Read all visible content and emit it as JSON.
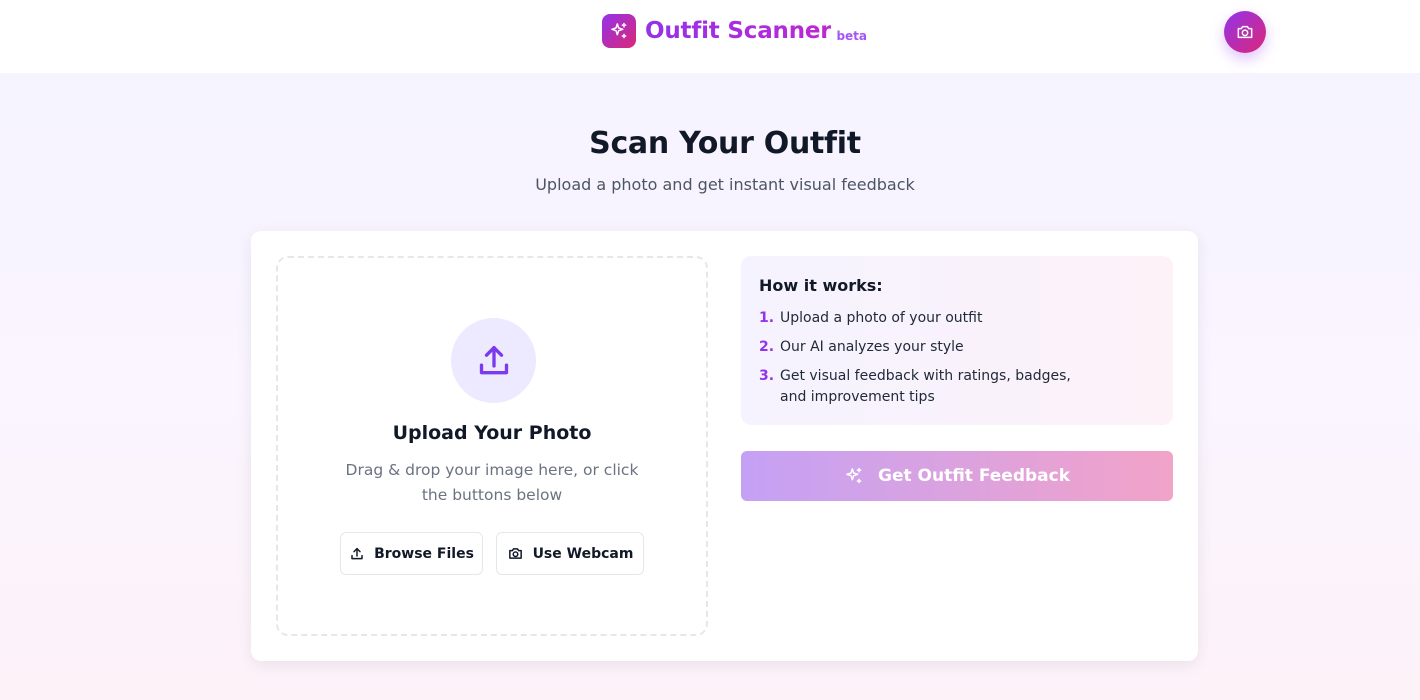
{
  "header": {
    "app_name": "Outfit Scanner",
    "badge": "beta",
    "logo_icon": "sparkles-icon",
    "camera_icon": "camera-icon"
  },
  "hero": {
    "title": "Scan Your Outfit",
    "subtitle": "Upload a photo and get instant visual feedback"
  },
  "upload": {
    "icon": "upload-icon",
    "title": "Upload Your Photo",
    "description": "Drag & drop your image here, or click the buttons below",
    "browse_label": "Browse Files",
    "webcam_label": "Use Webcam"
  },
  "how_it_works": {
    "title": "How it works:",
    "steps": [
      {
        "num": "1.",
        "text": "Upload a photo of your outfit"
      },
      {
        "num": "2.",
        "text": "Our AI analyzes your style"
      },
      {
        "num": "3.",
        "text": "Get visual feedback with ratings, badges, and improvement tips"
      }
    ]
  },
  "actions": {
    "feedback_label": "Get Outfit Feedback",
    "feedback_icon": "sparkles-icon"
  },
  "colors": {
    "accent_purple": "#9333ea",
    "accent_pink": "#db2777",
    "button_gradient_start": "#c4a1f5",
    "button_gradient_end": "#f2a3c8"
  }
}
